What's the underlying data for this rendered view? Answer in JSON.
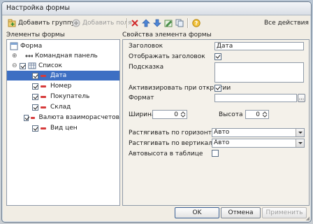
{
  "window": {
    "title": "Настройка формы"
  },
  "toolbar": {
    "add_group": "Добавить группу",
    "add_field": "Добавить поля",
    "all_actions": "Все действия"
  },
  "left_panel": {
    "header": "Элементы формы"
  },
  "right_panel": {
    "header": "Свойства элемента формы"
  },
  "tree": {
    "form": "Форма",
    "command_panel": "Командная панель",
    "list": "Список",
    "items": [
      {
        "label": "Дата",
        "checked": true,
        "selected": true
      },
      {
        "label": "Номер",
        "checked": true,
        "selected": false
      },
      {
        "label": "Покупатель",
        "checked": true,
        "selected": false
      },
      {
        "label": "Склад",
        "checked": true,
        "selected": false
      },
      {
        "label": "Валюта взаиморасчетов",
        "checked": true,
        "selected": false
      },
      {
        "label": "Вид цен",
        "checked": true,
        "selected": false
      }
    ]
  },
  "props": {
    "title_label": "Заголовок",
    "title_value": "Дата",
    "show_title_label": "Отображать заголовок",
    "show_title_checked": true,
    "tooltip_label": "Подсказка",
    "activate_label": "Активизировать при открытии",
    "activate_checked": true,
    "format_label": "Формат",
    "format_button": "...",
    "width_label": "Ширина",
    "width_value": "0",
    "height_label": "Высота",
    "height_value": "0",
    "stretch_h_label": "Растягивать по горизонтали",
    "stretch_h_value": "Авто",
    "stretch_v_label": "Растягивать по вертикали",
    "stretch_v_value": "Авто",
    "autoheight_label": "Автовысота в таблице",
    "autoheight_checked": false
  },
  "buttons": {
    "ok": "OK",
    "cancel": "Отмена",
    "apply": "Применить"
  }
}
